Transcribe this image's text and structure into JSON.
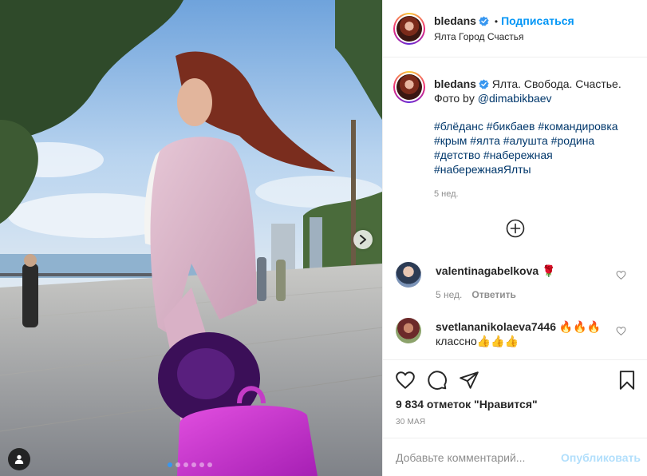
{
  "post": {
    "username": "bledans",
    "follow_label": "Подписаться",
    "separator": "•",
    "location": "Ялта Город Счастья",
    "slides_total": 6,
    "slide_active": 1
  },
  "caption": {
    "username": "bledans",
    "text": "Ялта. Свобода. Счастье.\nФото by ",
    "mention": "@dimabikbaev",
    "hashtags": [
      "#блёданс",
      "#бикбаев",
      "#командировка",
      "#крым",
      "#ялта",
      "#алушта",
      "#родина",
      "#детство",
      "#набережная",
      "#набережнаяЯлты"
    ],
    "time": "5 нед."
  },
  "comments": [
    {
      "username": "valentinagabelkova",
      "text": "🌹",
      "time": "5 нед.",
      "reply_label": "Ответить"
    },
    {
      "username": "svetlananikolaeva7446",
      "text": "🔥🔥🔥",
      "text2": "классно👍👍👍"
    }
  ],
  "stats": {
    "likes": "9 834 отметок \"Нравится\"",
    "date": "30 МАЯ"
  },
  "comment_box": {
    "placeholder": "Добавьте комментарий...",
    "post_label": "Опубликовать"
  },
  "icons": [
    "chevron-right-icon",
    "user-tag-icon",
    "verified-icon",
    "plus-circle-icon",
    "heart-icon",
    "comment-icon",
    "share-icon",
    "bookmark-icon"
  ],
  "colors": {
    "accent": "#0095f6",
    "link": "#00376b",
    "muted": "#8e8e8e",
    "post_disabled": "#b2dffc"
  }
}
